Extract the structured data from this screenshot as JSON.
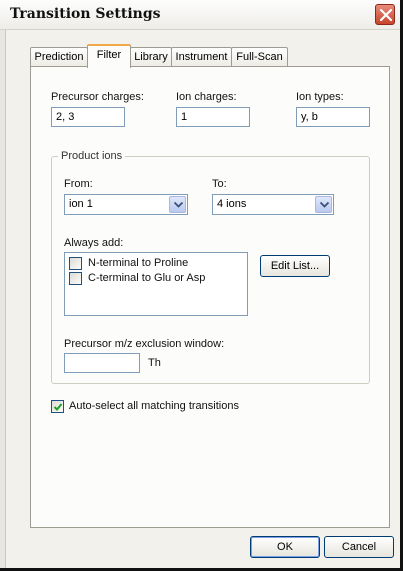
{
  "window": {
    "title": "Transition Settings"
  },
  "tabs": [
    {
      "label": "Prediction"
    },
    {
      "label": "Filter"
    },
    {
      "label": "Library"
    },
    {
      "label": "Instrument"
    },
    {
      "label": "Full-Scan"
    }
  ],
  "active_tab": "Filter",
  "filter": {
    "precursor_charges": {
      "label": "Precursor charges:",
      "value": "2, 3"
    },
    "ion_charges": {
      "label": "Ion charges:",
      "value": "1"
    },
    "ion_types": {
      "label": "Ion types:",
      "value": "y, b"
    },
    "product_ions": {
      "title": "Product ions",
      "from": {
        "label": "From:",
        "value": "ion 1"
      },
      "to": {
        "label": "To:",
        "value": "4 ions"
      },
      "always_add": {
        "label": "Always add:",
        "items": [
          {
            "label": "N-terminal to Proline",
            "checked": false
          },
          {
            "label": "C-terminal to Glu or Asp",
            "checked": false
          }
        ],
        "edit_list_label": "Edit List..."
      },
      "exclusion": {
        "label": "Precursor m/z exclusion window:",
        "value": "",
        "unit": "Th"
      }
    },
    "auto_select": {
      "label": "Auto-select all matching transitions",
      "checked": true
    }
  },
  "buttons": {
    "ok": "OK",
    "cancel": "Cancel"
  },
  "colors": {
    "close_button": "#c8442c",
    "active_tab_highlight": "#f0a84a",
    "input_border": "#7f9db9",
    "dialog_background": "#f2f1ec"
  }
}
